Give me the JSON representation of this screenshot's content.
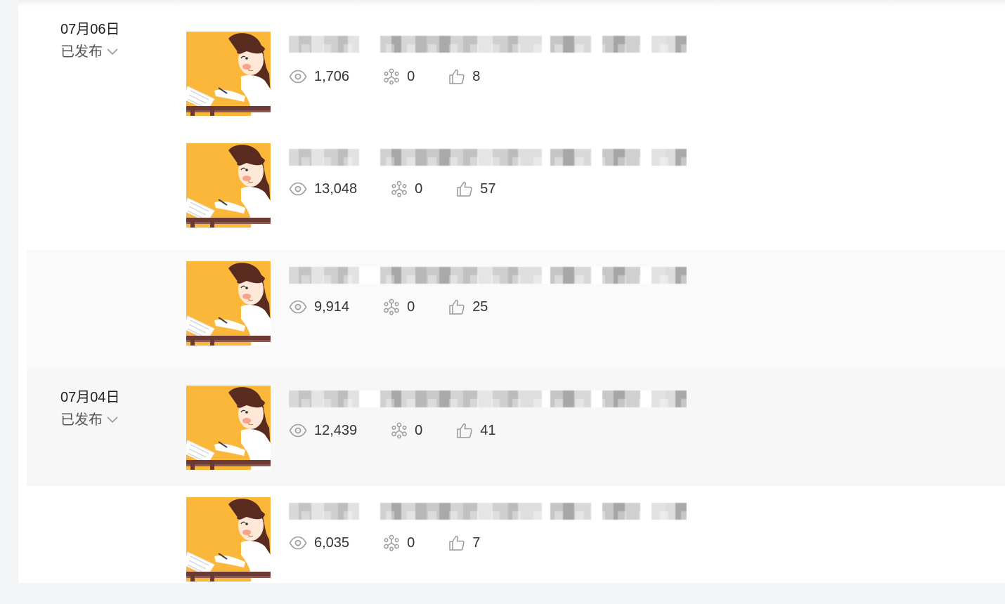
{
  "articles": [
    {
      "date": "07月06日",
      "status": "已发布",
      "views": "1,706",
      "shares": "0",
      "likes": "8",
      "title": "",
      "show_date": true,
      "state": ""
    },
    {
      "date": "",
      "status": "",
      "views": "13,048",
      "shares": "0",
      "likes": "57",
      "title": "",
      "show_date": false,
      "state": ""
    },
    {
      "date": "",
      "status": "",
      "views": "9,914",
      "shares": "0",
      "likes": "25",
      "title": "",
      "show_date": false,
      "state": "hovered"
    },
    {
      "date": "07月04日",
      "status": "已发布",
      "views": "12,439",
      "shares": "0",
      "likes": "41",
      "title": "",
      "show_date": true,
      "state": "active"
    },
    {
      "date": "",
      "status": "",
      "views": "6,035",
      "shares": "0",
      "likes": "7",
      "title": "",
      "show_date": false,
      "state": ""
    }
  ],
  "icons": {
    "views": "eye-icon",
    "shares": "share-icon",
    "likes": "thumbs-up-icon",
    "status_toggle": "chevron-down-icon"
  },
  "colors": {
    "thumbnail_bg": "#FBB73A",
    "hair": "#5A2C20",
    "desk": "#6B3A35",
    "icon_gray": "#9A9A9A"
  }
}
